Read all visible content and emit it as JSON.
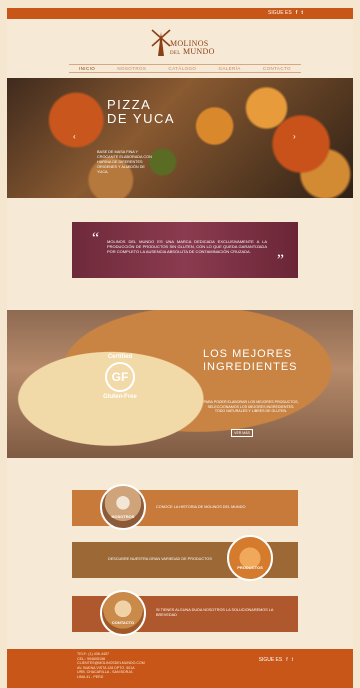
{
  "topbar": {
    "social_label": "SIGUE ES",
    "lang": "ES ▾",
    "icons": [
      "facebook-icon",
      "twitter-icon"
    ]
  },
  "logo": {
    "line1": "MOLINOS",
    "line2": "MUNDO",
    "prefix": "DEL"
  },
  "nav": {
    "items": [
      "INICIO",
      "NOSOTROS",
      "CATÁLOGO",
      "GALERÍA",
      "CONTACTO"
    ]
  },
  "hero": {
    "title_line1": "PIZZA",
    "title_line2": "DE YUCA",
    "description": "BASE DE MASA FINA Y CROCANTE ELABORADA CON HARINA DE DIFERENTES ORIGENES Y ALMIDÓN DE YUCA."
  },
  "quote": {
    "text": "MOLINOS DEL MUNDO ES UNA MARCA DEDICADA EXCLUSIVAMENTE A LA PRODUCCIÓN DE PRODUCTOS SIN GLUTEN, CON LO QUE QUEDA GARANTIZADA POR COMPLETO LA AUSENCIA ABSOLUTA DE CONTAMINACIÓN CRUZADA."
  },
  "bread": {
    "cert_top": "Certified",
    "cert_mid": "GF",
    "cert_bottom": "Gluten-Free",
    "heading_line1": "LOS MEJORES",
    "heading_line2": "INGREDIENTES",
    "description": "PARA PODER ELABORAR LOS MEJORES PRODUCTOS, SELECCIONAMOS LOS MEJORES INGREDIENTES. TODO NATURALES Y LIBRES DE GLUTEN.",
    "button": "VER MÁS"
  },
  "promos": [
    {
      "text": "CONOCE LA HISTORIA DE MOLINOS DEL MUNDO",
      "label": "NOSOTROS"
    },
    {
      "text": "DESCUBRE NUESTRA GRAN VARIEDAD DE PRODUCTOS",
      "label": "PRODUCTOS"
    },
    {
      "text": "SI TIENES ALGUNA DUDA NOSOTROS LA SOLUCIONAREMOS LA BREVEDAD",
      "label": "CONTACTO"
    }
  ],
  "footer": {
    "line1": "TELF.: (1) 436-4457",
    "line2": "CEL.: 994605198",
    "line3": "CLIENTES@MOLINOSDELMUNDO.COM",
    "line4": "AV. BUENA VISTA 128 DPTO. 501A",
    "line5": "URB. CHACARILLA - SAN BORJA",
    "line6": "LIMA 41 - PERÚ",
    "social_label": "SIGUE ES"
  }
}
